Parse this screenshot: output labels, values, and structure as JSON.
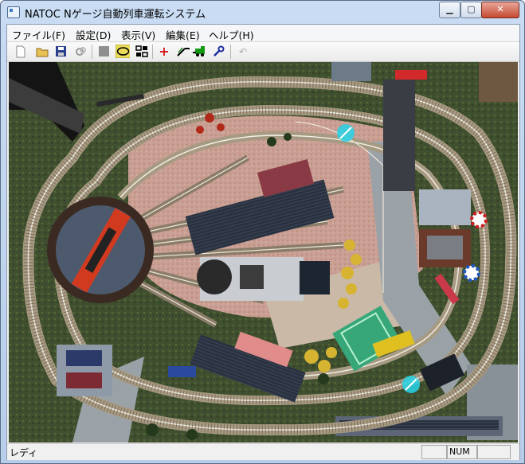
{
  "window": {
    "title": "NATOC Nゲージ自動列車運転システム"
  },
  "menu": [
    {
      "label": "ファイル(F)"
    },
    {
      "label": "設定(D)"
    },
    {
      "label": "表示(V)"
    },
    {
      "label": "編集(E)"
    },
    {
      "label": "ヘルプ(H)"
    }
  ],
  "toolbar": {
    "icons": [
      "new-icon",
      "open-icon",
      "save-icon",
      "tool-icon",
      "stop-icon",
      "track-oval-icon",
      "block-icon",
      "add-icon",
      "point-icon",
      "locomotive-icon",
      "sensor-icon",
      "undo-icon"
    ]
  },
  "status": {
    "text": "レディ",
    "num_indicator": "NUM"
  },
  "colors": {
    "track": "#f3efe4",
    "ballast": "#a79a82",
    "baseboard": "#3b4a2e",
    "selection": "#26d4e8"
  }
}
